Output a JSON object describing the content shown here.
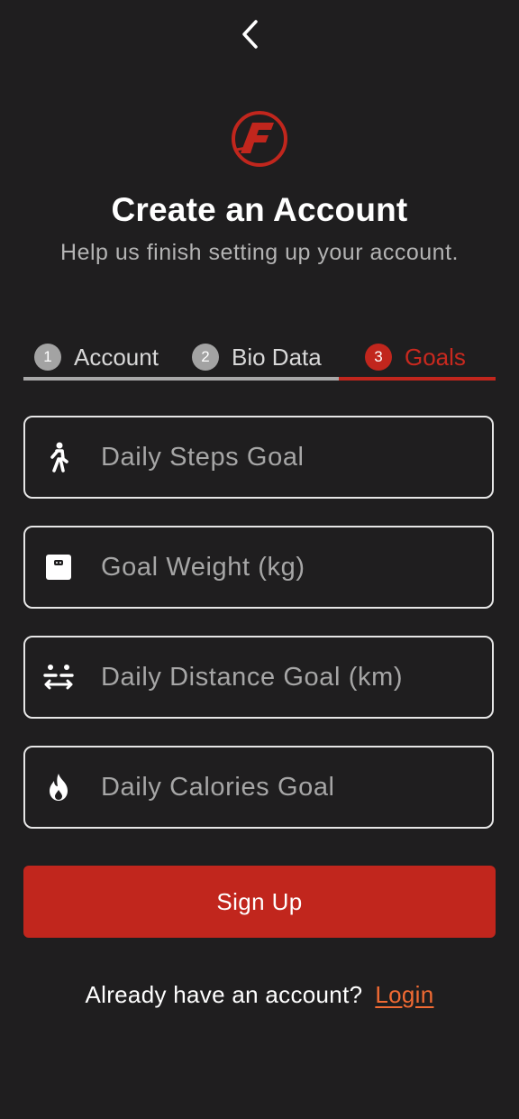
{
  "header": {
    "back_icon": "chevron-left-icon",
    "logo_icon": "brand-f-logo"
  },
  "title": "Create an Account",
  "subtitle": "Help us finish setting up your account.",
  "steps": [
    {
      "number": "1",
      "label": "Account",
      "active": false
    },
    {
      "number": "2",
      "label": "Bio Data",
      "active": false
    },
    {
      "number": "3",
      "label": "Goals",
      "active": true
    }
  ],
  "fields": [
    {
      "icon": "walking-person-icon",
      "value": "",
      "placeholder": "Daily Steps Goal"
    },
    {
      "icon": "weight-scale-icon",
      "value": "",
      "placeholder": "Goal Weight (kg)"
    },
    {
      "icon": "distance-icon",
      "value": "",
      "placeholder": "Daily Distance Goal (km)"
    },
    {
      "icon": "flame-icon",
      "value": "",
      "placeholder": "Daily Calories Goal"
    }
  ],
  "signup_button": "Sign Up",
  "footer": {
    "prompt": "Already have an account?",
    "login_link": "Login"
  },
  "colors": {
    "background": "#1f1e1f",
    "accent": "#c1261d",
    "link": "#f06a33",
    "step_inactive": "#a3a3a3"
  }
}
